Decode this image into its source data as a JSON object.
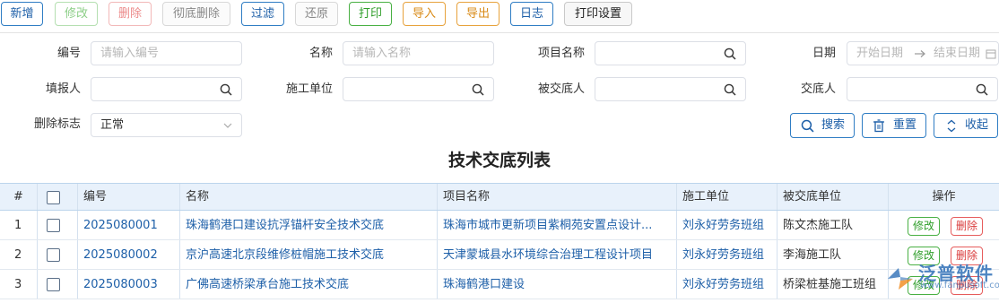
{
  "toolbar": {
    "add": "新增",
    "edit": "修改",
    "delete": "删除",
    "purge": "彻底删除",
    "filter": "过滤",
    "restore": "还原",
    "print": "打印",
    "import": "导入",
    "export": "导出",
    "log": "日志",
    "print_settings": "打印设置"
  },
  "filters": {
    "code_label": "编号",
    "code_placeholder": "请输入编号",
    "name_label": "名称",
    "name_placeholder": "请输入名称",
    "project_label": "项目名称",
    "date_label": "日期",
    "date_start": "开始日期",
    "date_end": "结束日期",
    "reporter_label": "填报人",
    "unit_label": "施工单位",
    "recipient_label": "被交底人",
    "discloser_label": "交底人",
    "deleted_label": "删除标志",
    "deleted_value": "正常",
    "search_btn": "搜索",
    "reset_btn": "重置",
    "collapse_btn": "收起"
  },
  "table_title": "技术交底列表",
  "table": {
    "headers": {
      "num": "#",
      "code": "编号",
      "name": "名称",
      "project": "项目名称",
      "unit": "施工单位",
      "recipient": "被交底单位",
      "ops": "操作"
    },
    "op_edit": "修改",
    "op_delete": "删除",
    "rows": [
      {
        "num": "1",
        "code": "2025080001",
        "name": "珠海鹤港口建设抗浮锚杆安全技术交底",
        "project": "珠海市城市更新项目紫桐苑安置点设计...",
        "unit": "刘永好劳务班组",
        "recipient": "陈文杰施工队"
      },
      {
        "num": "2",
        "code": "2025080002",
        "name": "京沪高速北京段维修桩帽施工技术交底",
        "project": "天津蒙城县水环境综合治理工程设计项目",
        "unit": "刘永好劳务班组",
        "recipient": "李海施工队"
      },
      {
        "num": "3",
        "code": "2025080003",
        "name": "广佛高速桥梁承台施工技术交底",
        "project": "珠海鹤港口建设",
        "unit": "刘永好劳务班组",
        "recipient": "桥梁桩基施工班组"
      }
    ]
  },
  "watermark": {
    "text": "泛普软件",
    "url": "www.fanpusoft.com"
  },
  "colors": {
    "accent": "#1d5fa8",
    "header_bg": "#e8f1fb",
    "green": "#2f9e2a",
    "red": "#d93b3b",
    "orange": "#d98a15"
  }
}
